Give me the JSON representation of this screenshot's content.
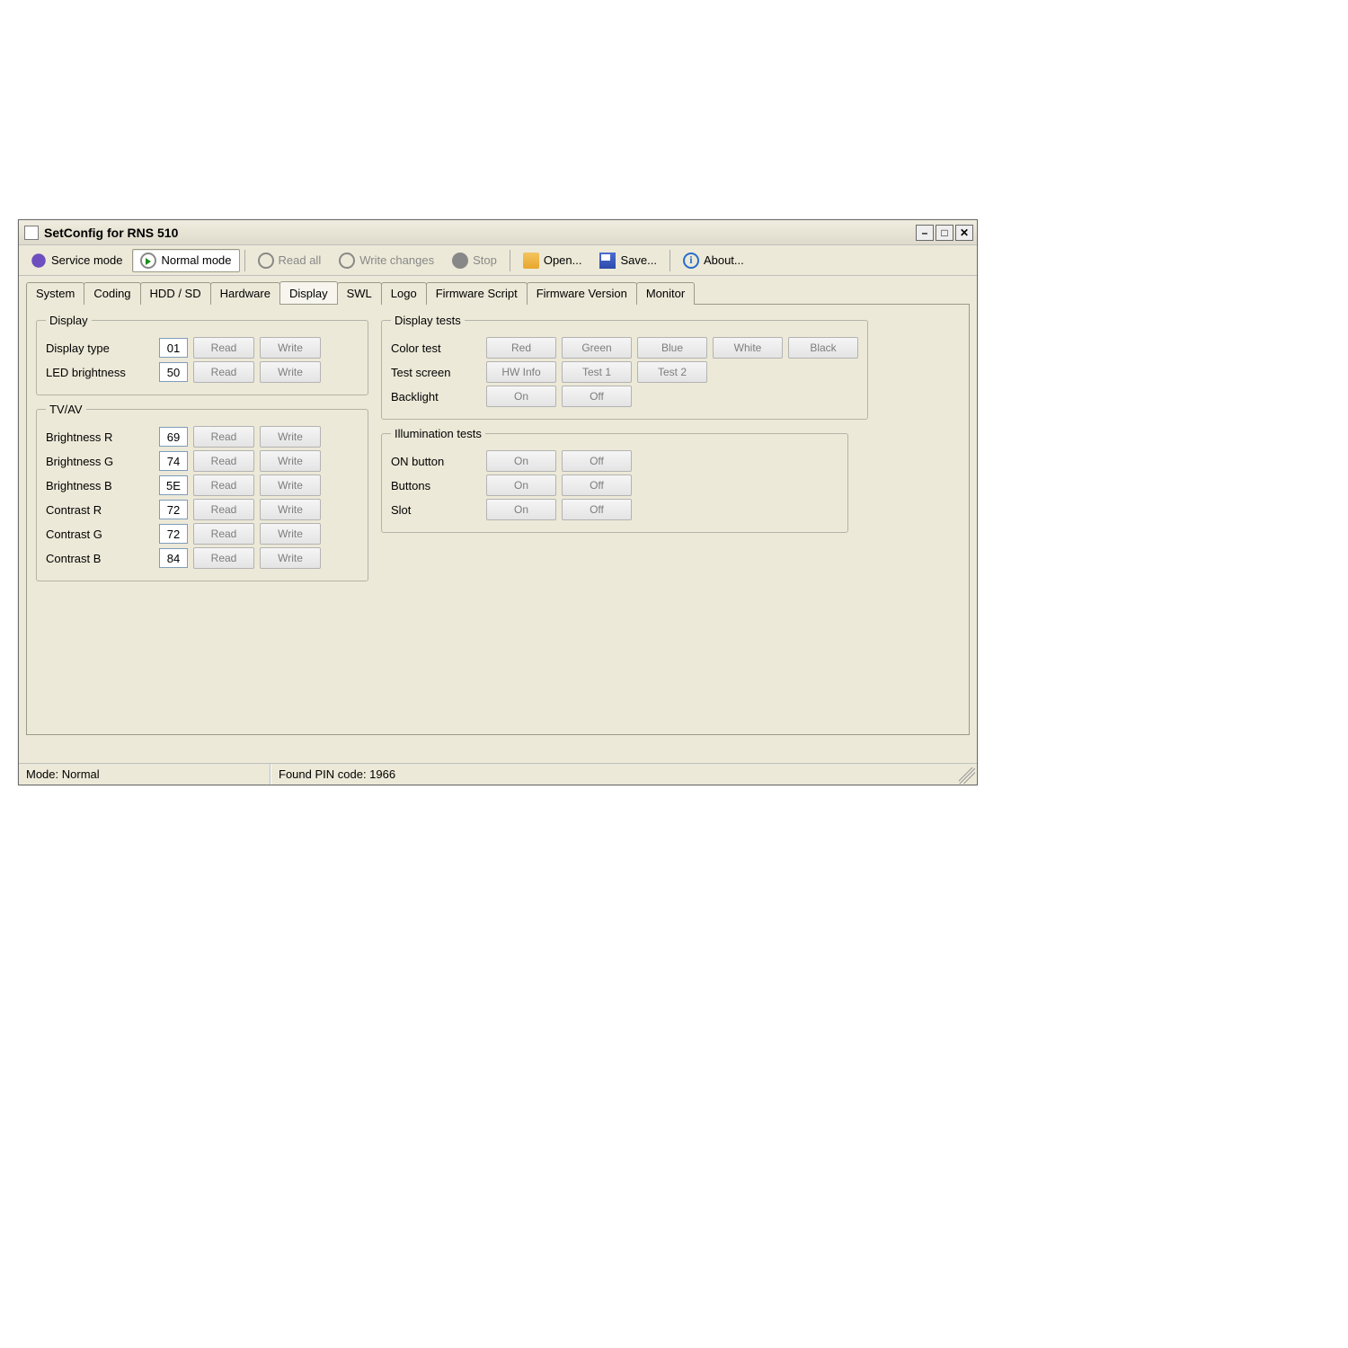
{
  "window": {
    "title": "SetConfig for RNS 510"
  },
  "toolbar": {
    "service_mode": "Service mode",
    "normal_mode": "Normal mode",
    "read_all": "Read all",
    "write_changes": "Write changes",
    "stop": "Stop",
    "open": "Open...",
    "save": "Save...",
    "about": "About..."
  },
  "tabs": {
    "system": "System",
    "coding": "Coding",
    "hdd_sd": "HDD / SD",
    "hardware": "Hardware",
    "display": "Display",
    "swl": "SWL",
    "logo": "Logo",
    "firmware_script": "Firmware Script",
    "firmware_version": "Firmware Version",
    "monitor": "Monitor"
  },
  "groups": {
    "display": "Display",
    "tvav": "TV/AV",
    "display_tests": "Display tests",
    "illumination_tests": "Illumination tests"
  },
  "labels": {
    "display_type": "Display type",
    "led_brightness": "LED brightness",
    "brightness_r": "Brightness R",
    "brightness_g": "Brightness G",
    "brightness_b": "Brightness B",
    "contrast_r": "Contrast R",
    "contrast_g": "Contrast G",
    "contrast_b": "Contrast B",
    "color_test": "Color test",
    "test_screen": "Test screen",
    "backlight": "Backlight",
    "on_button": "ON button",
    "buttons": "Buttons",
    "slot": "Slot"
  },
  "actions": {
    "read": "Read",
    "write": "Write",
    "red": "Red",
    "green": "Green",
    "blue": "Blue",
    "white": "White",
    "black": "Black",
    "hw_info": "HW Info",
    "test1": "Test 1",
    "test2": "Test 2",
    "on": "On",
    "off": "Off"
  },
  "values": {
    "display_type": "01",
    "led_brightness": "50",
    "brightness_r": "69",
    "brightness_g": "74",
    "brightness_b": "5E",
    "contrast_r": "72",
    "contrast_g": "72",
    "contrast_b": "84"
  },
  "status": {
    "mode": "Mode: Normal",
    "pin": "Found PIN code: 1966"
  }
}
